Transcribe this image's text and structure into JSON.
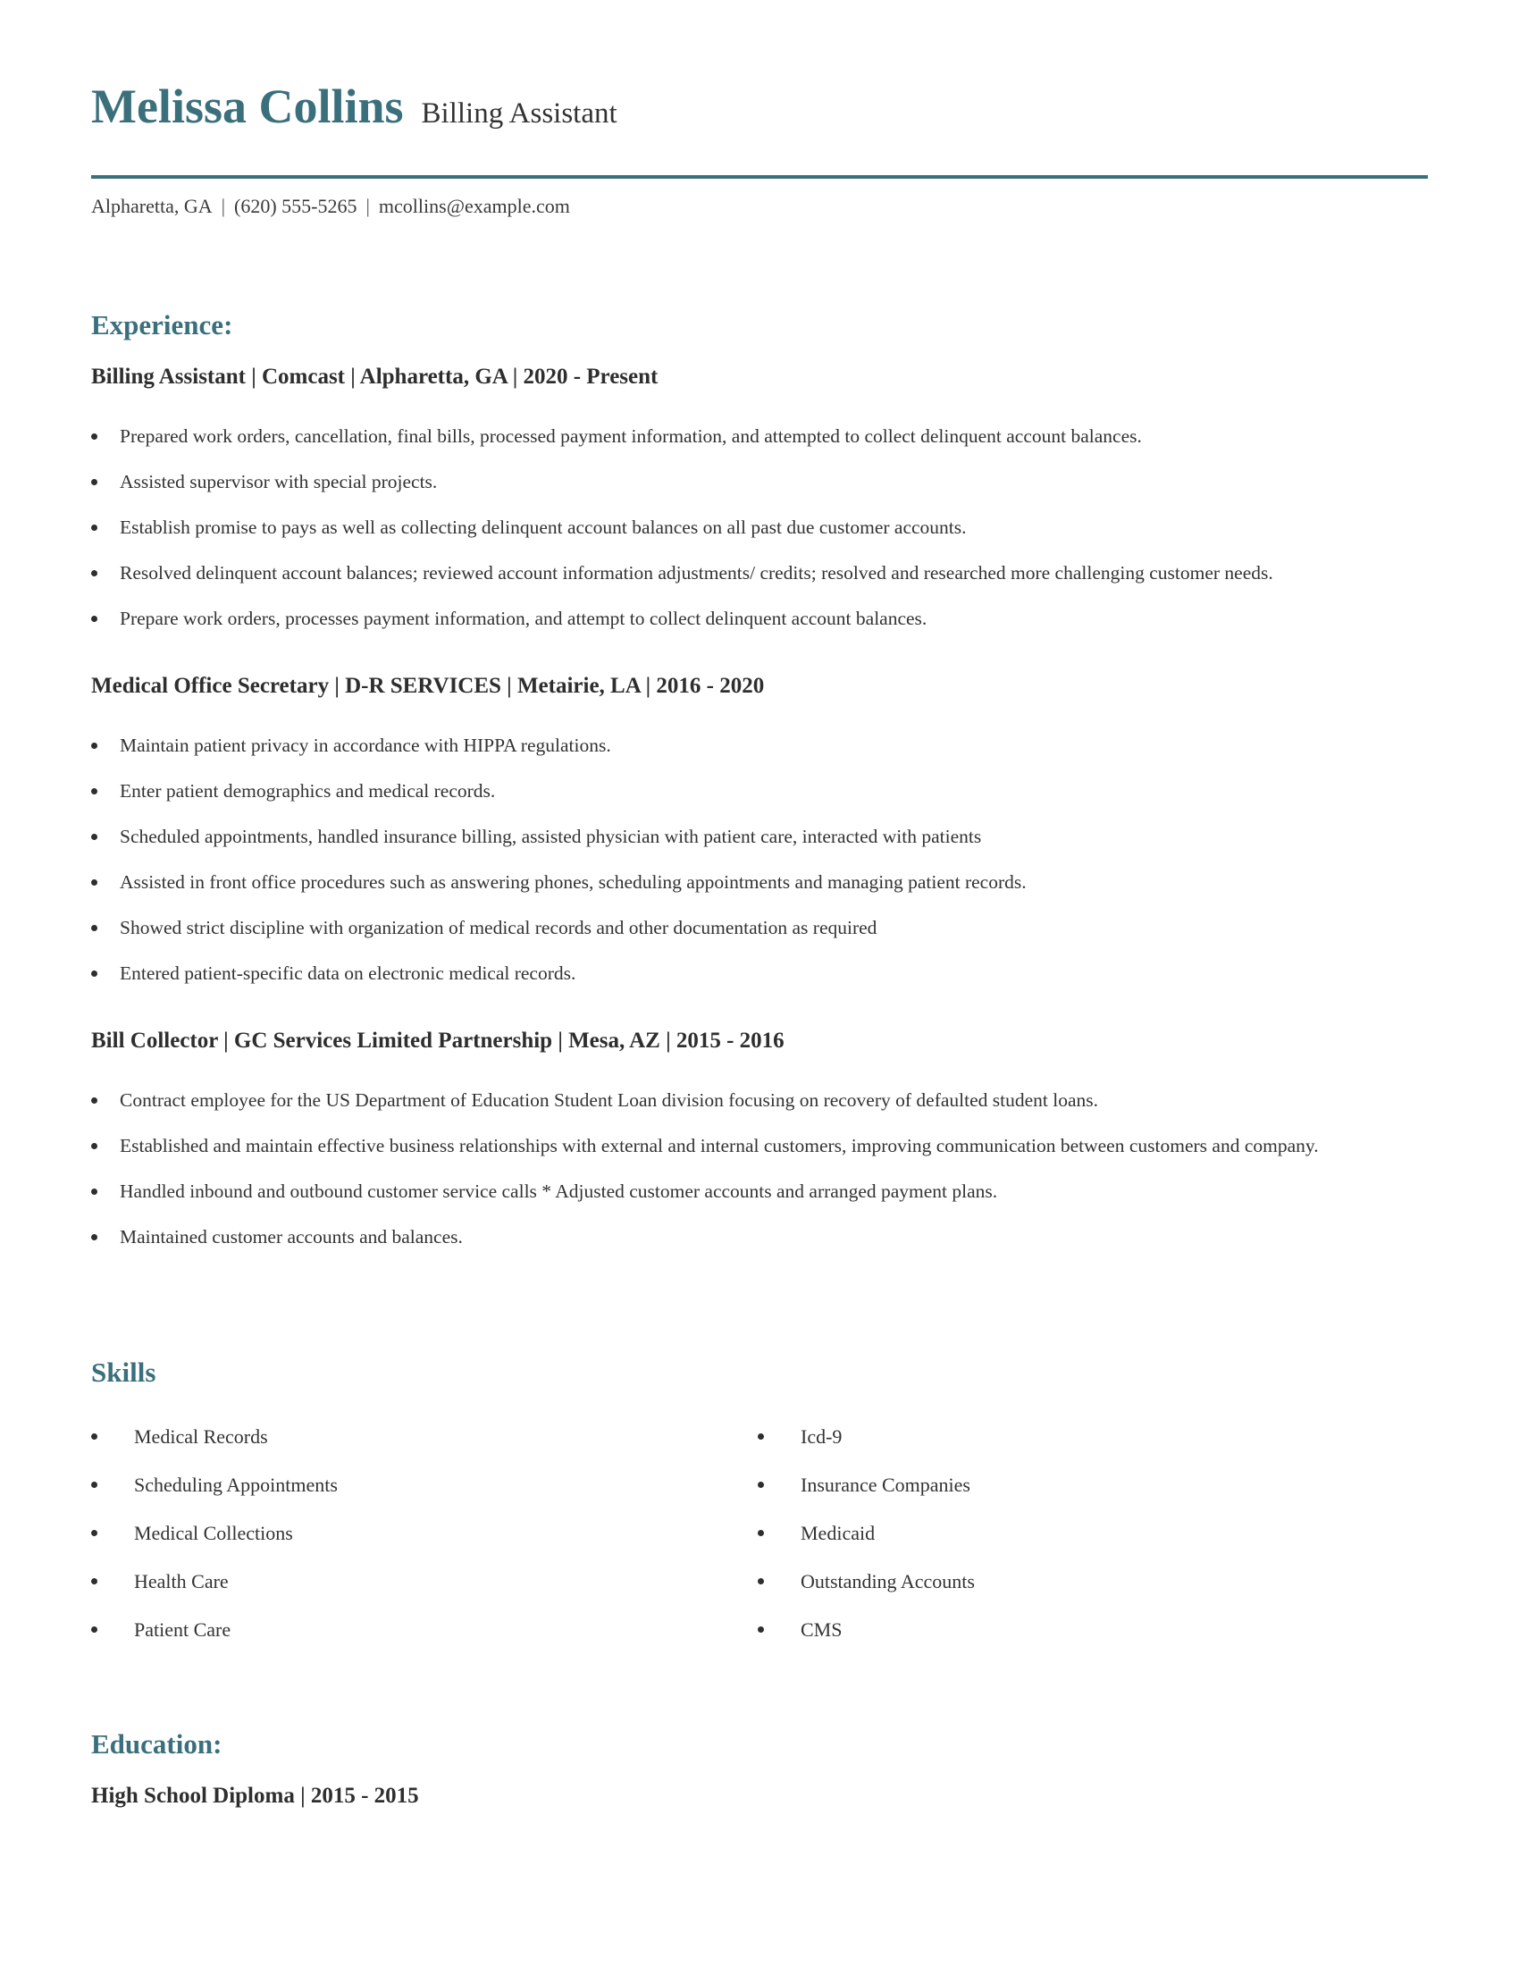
{
  "header": {
    "name": "Melissa Collins",
    "role": "Billing Assistant",
    "contact": {
      "location": "Alpharetta, GA",
      "phone": "(620) 555-5265",
      "email": "mcollins@example.com",
      "separator": "|"
    }
  },
  "colors": {
    "accent": "#3a6f7c",
    "text": "#2e2e2e"
  },
  "experience": {
    "title": "Experience:",
    "jobs": [
      {
        "heading": "Billing Assistant | Comcast | Alpharetta, GA |  2020 - Present",
        "bullets": [
          "Prepared work orders, cancellation, final bills, processed payment information, and attempted to collect delinquent account balances.",
          "Assisted supervisor with special projects.",
          "Establish promise to pays as well as collecting delinquent account balances on all past due customer accounts.",
          "Resolved delinquent account balances; reviewed account information adjustments/ credits; resolved and researched more challenging customer needs.",
          "Prepare work orders, processes payment information, and attempt to collect delinquent account balances."
        ]
      },
      {
        "heading": "Medical Office Secretary | D-R SERVICES | Metairie, LA |  2016 - 2020",
        "bullets": [
          "Maintain patient privacy in accordance with HIPPA regulations.",
          "Enter patient demographics and medical records.",
          "Scheduled appointments, handled insurance billing, assisted physician with patient care, interacted with patients",
          "Assisted in front office procedures such as answering phones, scheduling appointments and managing patient records.",
          "Showed strict discipline with organization of medical records and other documentation as required",
          "Entered patient-specific data on electronic medical records."
        ]
      },
      {
        "heading": "Bill Collector | GC Services Limited Partnership | Mesa, AZ |  2015 - 2016",
        "bullets": [
          "Contract employee for the US Department of Education Student Loan division focusing on recovery of defaulted student loans.",
          "Established and maintain effective business relationships with external and internal customers, improving communication between customers and company.",
          "Handled inbound and outbound customer service calls * Adjusted customer accounts and arranged payment plans.",
          "Maintained customer accounts and balances."
        ]
      }
    ]
  },
  "skills": {
    "title": "Skills",
    "left": [
      "Medical Records",
      "Scheduling Appointments",
      "Medical Collections",
      "Health Care",
      "Patient Care"
    ],
    "right": [
      "Icd-9",
      "Insurance Companies",
      "Medicaid",
      "Outstanding Accounts",
      "CMS"
    ]
  },
  "education": {
    "title": "Education:",
    "entries": [
      {
        "heading": "High School Diploma |  2015 - 2015"
      }
    ]
  }
}
